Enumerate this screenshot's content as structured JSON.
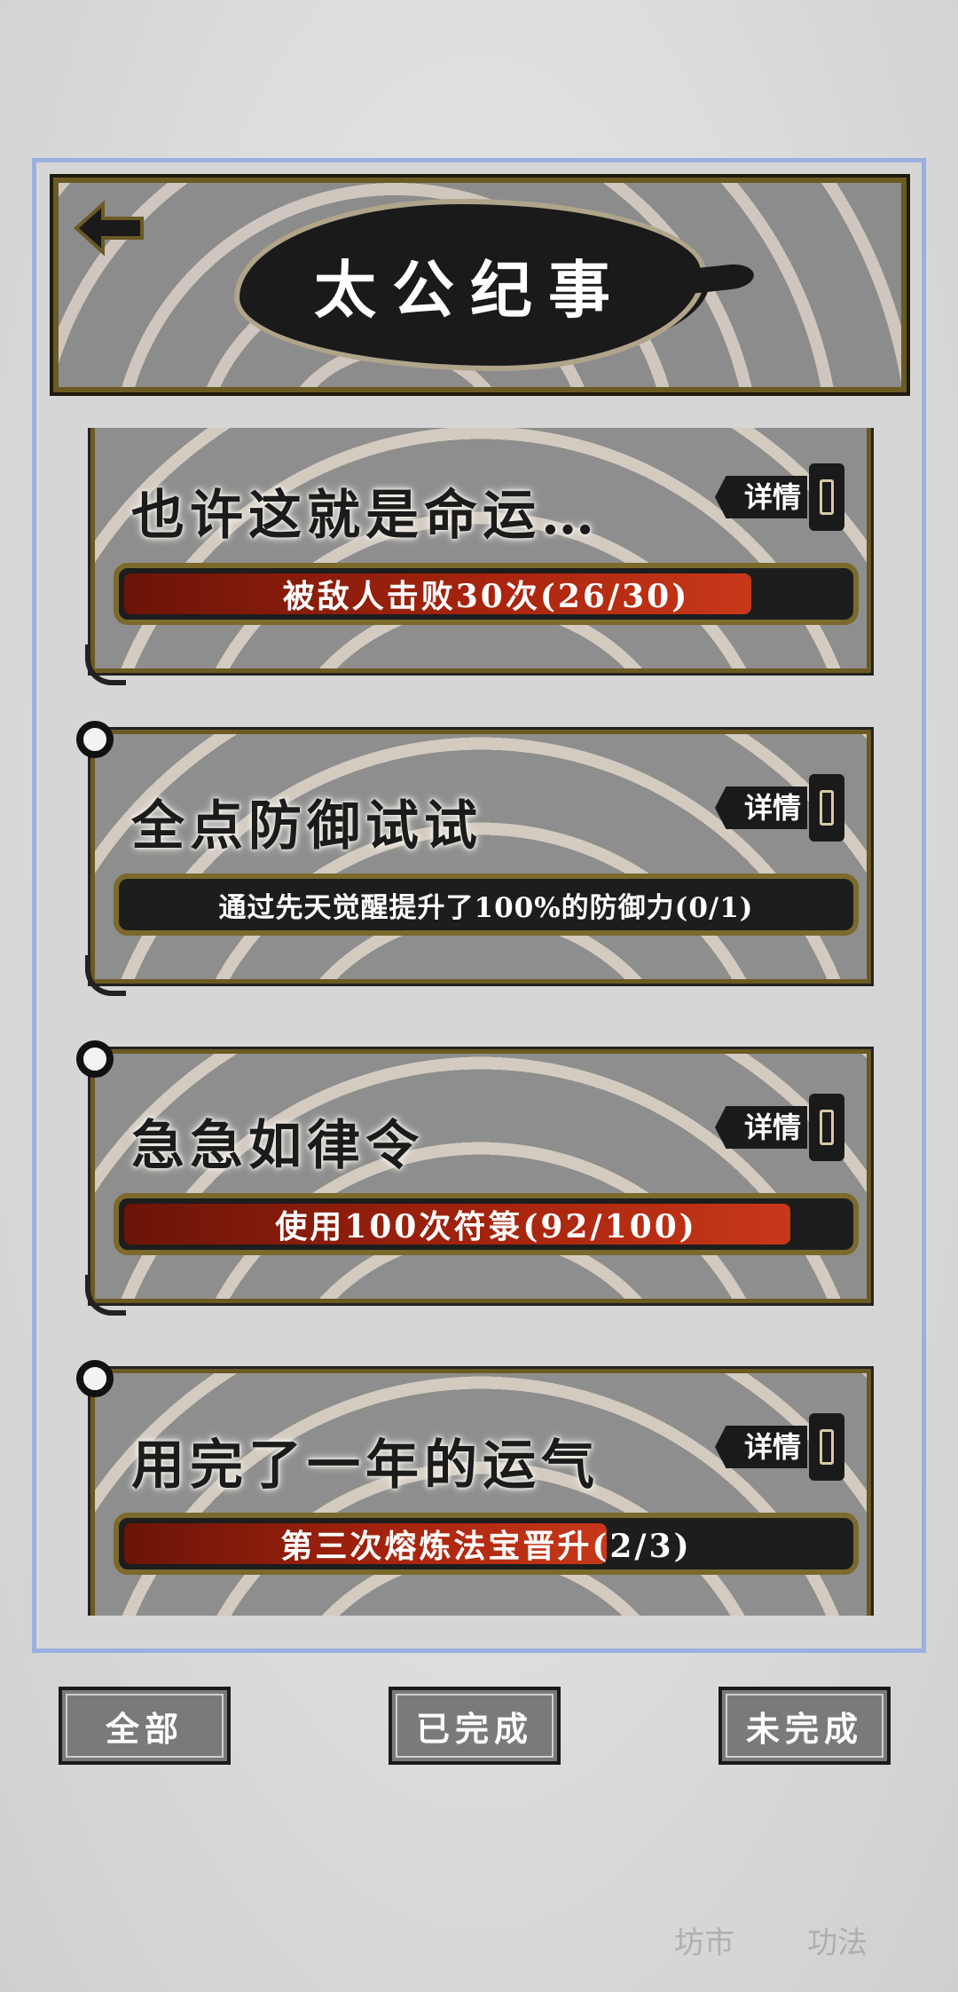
{
  "header": {
    "title": "太公纪事"
  },
  "achievements": [
    {
      "title": "也许这就是命运…",
      "detail_label": "详情",
      "progress_text": "被敌人击败30次(26/30)",
      "progress": 0.867
    },
    {
      "title": "全点防御试试",
      "detail_label": "详情",
      "progress_text": "通过先天觉醒提升了100%的防御力(0/1)",
      "progress": 0
    },
    {
      "title": "急急如律令",
      "detail_label": "详情",
      "progress_text": "使用100次符箓(92/100)",
      "progress": 0.92
    },
    {
      "title": "用完了一年的运气",
      "detail_label": "详情",
      "progress_text": "第三次熔炼法宝晋升(2/3)",
      "progress": 0.667
    }
  ],
  "filters": {
    "all": "全部",
    "completed": "已完成",
    "incomplete": "未完成"
  },
  "background_nav": {
    "market": "坊市",
    "technique": "功法"
  },
  "colors": {
    "progress_fill": "#a9250e",
    "frame_gold": "#6b5a22",
    "panel_border": "#9bb0e0"
  }
}
